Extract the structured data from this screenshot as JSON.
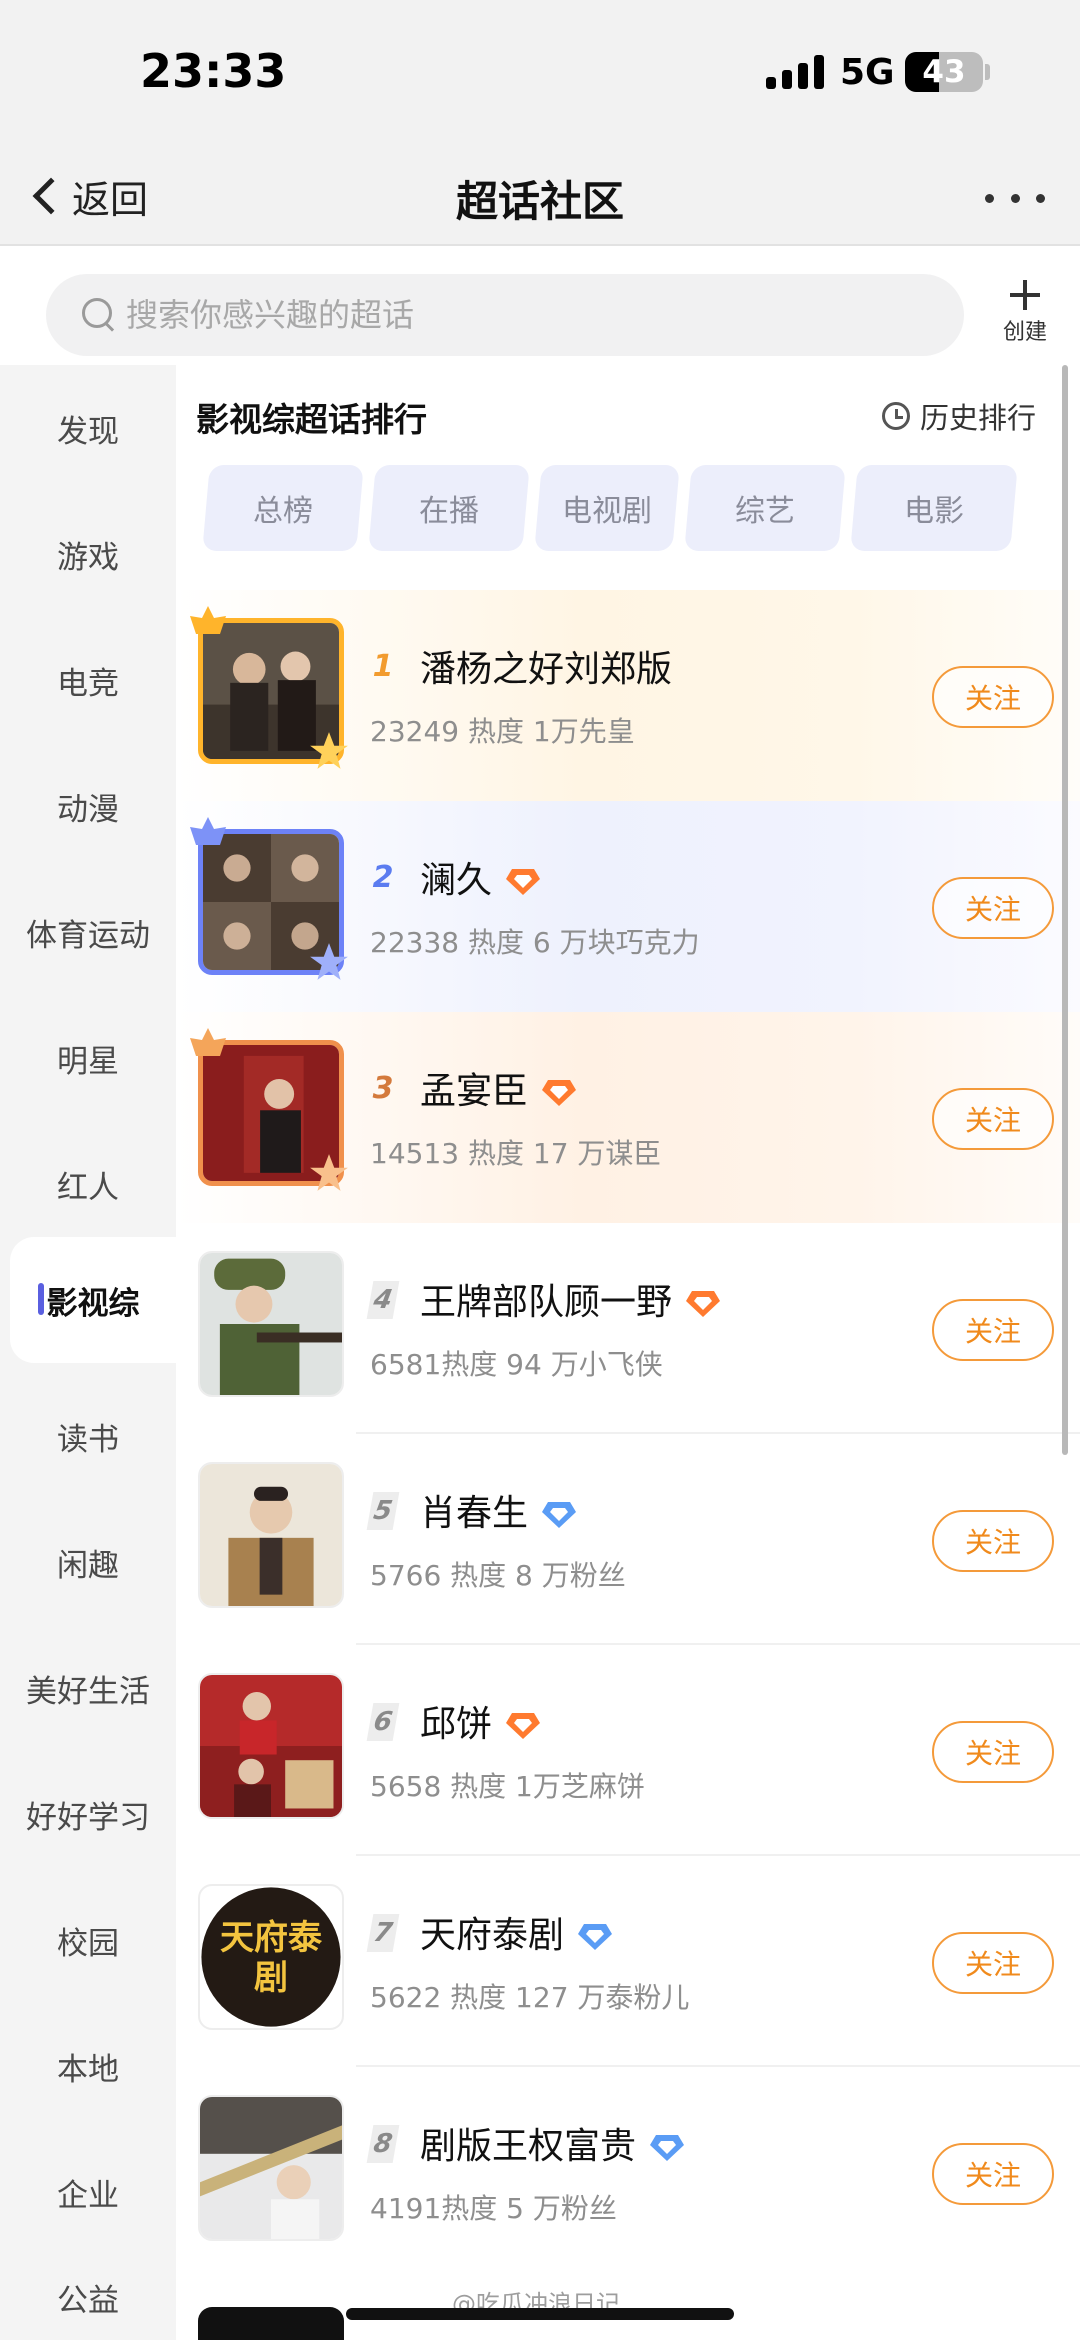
{
  "status_bar": {
    "time": "23:33",
    "network": "5G",
    "battery": "43",
    "battery_level": 0.43
  },
  "nav": {
    "back_label": "返回",
    "title": "超话社区"
  },
  "search": {
    "placeholder": "搜索你感兴趣的超话",
    "create_label": "创建"
  },
  "sidebar": {
    "items": [
      {
        "label": "发现"
      },
      {
        "label": "游戏"
      },
      {
        "label": "电竞"
      },
      {
        "label": "动漫"
      },
      {
        "label": "体育运动"
      },
      {
        "label": "明星"
      },
      {
        "label": "红人"
      },
      {
        "label": "影视综",
        "active": true
      },
      {
        "label": "读书"
      },
      {
        "label": "闲趣"
      },
      {
        "label": "美好生活"
      },
      {
        "label": "好好学习"
      },
      {
        "label": "校园"
      },
      {
        "label": "本地"
      },
      {
        "label": "企业"
      },
      {
        "label": "公益"
      }
    ]
  },
  "main": {
    "section_title": "影视综超话排行",
    "history_label": "历史排行",
    "tabs": [
      {
        "label": "总榜"
      },
      {
        "label": "在播"
      },
      {
        "label": "电视剧"
      },
      {
        "label": "综艺"
      },
      {
        "label": "电影"
      }
    ]
  },
  "ranking": [
    {
      "rank": "1",
      "name": "潘杨之好刘郑版",
      "stats": "23249 热度 1万先皇",
      "follow": "关注",
      "badge": ""
    },
    {
      "rank": "2",
      "name": "澜久",
      "stats": "22338 热度 6 万块巧克力",
      "follow": "关注",
      "badge": "orange-diamond-badge"
    },
    {
      "rank": "3",
      "name": "孟宴臣",
      "stats": "14513 热度 17 万谋臣",
      "follow": "关注",
      "badge": "orange-diamond-badge"
    },
    {
      "rank": "4",
      "name": "王牌部队顾一野",
      "stats": "6581热度 94 万小飞侠",
      "follow": "关注",
      "badge": "orange-diamond-badge"
    },
    {
      "rank": "5",
      "name": "肖春生",
      "stats": "5766 热度 8 万粉丝",
      "follow": "关注",
      "badge": "blue-diamond-badge"
    },
    {
      "rank": "6",
      "name": "邱饼",
      "stats": "5658 热度 1万芝麻饼",
      "follow": "关注",
      "badge": "orange-diamond-badge"
    },
    {
      "rank": "7",
      "name": "天府泰剧",
      "stats": "5622 热度 127 万泰粉儿",
      "follow": "关注",
      "badge": "blue-diamond-badge",
      "avatar_text": "天府泰剧"
    },
    {
      "rank": "8",
      "name": "剧版王权富贵",
      "stats": "4191热度 5 万粉丝",
      "follow": "关注",
      "badge": "blue-diamond-badge"
    }
  ],
  "watermark": "@吃瓜冲浪日记",
  "colors": {
    "accent": "#f08a1c",
    "active_indicator": "#5a5fe0",
    "gold": "#ffb42b",
    "blue": "#6d82f7"
  }
}
